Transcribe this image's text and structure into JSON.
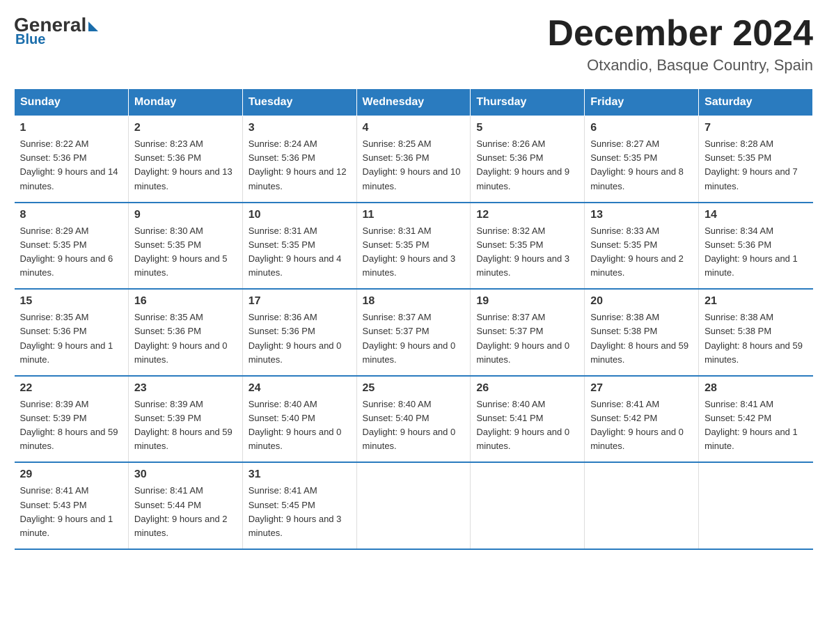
{
  "logo": {
    "general": "General",
    "blue": "Blue"
  },
  "header": {
    "month": "December 2024",
    "location": "Otxandio, Basque Country, Spain"
  },
  "weekdays": [
    "Sunday",
    "Monday",
    "Tuesday",
    "Wednesday",
    "Thursday",
    "Friday",
    "Saturday"
  ],
  "weeks": [
    [
      {
        "day": "1",
        "sunrise": "8:22 AM",
        "sunset": "5:36 PM",
        "daylight": "9 hours and 14 minutes."
      },
      {
        "day": "2",
        "sunrise": "8:23 AM",
        "sunset": "5:36 PM",
        "daylight": "9 hours and 13 minutes."
      },
      {
        "day": "3",
        "sunrise": "8:24 AM",
        "sunset": "5:36 PM",
        "daylight": "9 hours and 12 minutes."
      },
      {
        "day": "4",
        "sunrise": "8:25 AM",
        "sunset": "5:36 PM",
        "daylight": "9 hours and 10 minutes."
      },
      {
        "day": "5",
        "sunrise": "8:26 AM",
        "sunset": "5:36 PM",
        "daylight": "9 hours and 9 minutes."
      },
      {
        "day": "6",
        "sunrise": "8:27 AM",
        "sunset": "5:35 PM",
        "daylight": "9 hours and 8 minutes."
      },
      {
        "day": "7",
        "sunrise": "8:28 AM",
        "sunset": "5:35 PM",
        "daylight": "9 hours and 7 minutes."
      }
    ],
    [
      {
        "day": "8",
        "sunrise": "8:29 AM",
        "sunset": "5:35 PM",
        "daylight": "9 hours and 6 minutes."
      },
      {
        "day": "9",
        "sunrise": "8:30 AM",
        "sunset": "5:35 PM",
        "daylight": "9 hours and 5 minutes."
      },
      {
        "day": "10",
        "sunrise": "8:31 AM",
        "sunset": "5:35 PM",
        "daylight": "9 hours and 4 minutes."
      },
      {
        "day": "11",
        "sunrise": "8:31 AM",
        "sunset": "5:35 PM",
        "daylight": "9 hours and 3 minutes."
      },
      {
        "day": "12",
        "sunrise": "8:32 AM",
        "sunset": "5:35 PM",
        "daylight": "9 hours and 3 minutes."
      },
      {
        "day": "13",
        "sunrise": "8:33 AM",
        "sunset": "5:35 PM",
        "daylight": "9 hours and 2 minutes."
      },
      {
        "day": "14",
        "sunrise": "8:34 AM",
        "sunset": "5:36 PM",
        "daylight": "9 hours and 1 minute."
      }
    ],
    [
      {
        "day": "15",
        "sunrise": "8:35 AM",
        "sunset": "5:36 PM",
        "daylight": "9 hours and 1 minute."
      },
      {
        "day": "16",
        "sunrise": "8:35 AM",
        "sunset": "5:36 PM",
        "daylight": "9 hours and 0 minutes."
      },
      {
        "day": "17",
        "sunrise": "8:36 AM",
        "sunset": "5:36 PM",
        "daylight": "9 hours and 0 minutes."
      },
      {
        "day": "18",
        "sunrise": "8:37 AM",
        "sunset": "5:37 PM",
        "daylight": "9 hours and 0 minutes."
      },
      {
        "day": "19",
        "sunrise": "8:37 AM",
        "sunset": "5:37 PM",
        "daylight": "9 hours and 0 minutes."
      },
      {
        "day": "20",
        "sunrise": "8:38 AM",
        "sunset": "5:38 PM",
        "daylight": "8 hours and 59 minutes."
      },
      {
        "day": "21",
        "sunrise": "8:38 AM",
        "sunset": "5:38 PM",
        "daylight": "8 hours and 59 minutes."
      }
    ],
    [
      {
        "day": "22",
        "sunrise": "8:39 AM",
        "sunset": "5:39 PM",
        "daylight": "8 hours and 59 minutes."
      },
      {
        "day": "23",
        "sunrise": "8:39 AM",
        "sunset": "5:39 PM",
        "daylight": "8 hours and 59 minutes."
      },
      {
        "day": "24",
        "sunrise": "8:40 AM",
        "sunset": "5:40 PM",
        "daylight": "9 hours and 0 minutes."
      },
      {
        "day": "25",
        "sunrise": "8:40 AM",
        "sunset": "5:40 PM",
        "daylight": "9 hours and 0 minutes."
      },
      {
        "day": "26",
        "sunrise": "8:40 AM",
        "sunset": "5:41 PM",
        "daylight": "9 hours and 0 minutes."
      },
      {
        "day": "27",
        "sunrise": "8:41 AM",
        "sunset": "5:42 PM",
        "daylight": "9 hours and 0 minutes."
      },
      {
        "day": "28",
        "sunrise": "8:41 AM",
        "sunset": "5:42 PM",
        "daylight": "9 hours and 1 minute."
      }
    ],
    [
      {
        "day": "29",
        "sunrise": "8:41 AM",
        "sunset": "5:43 PM",
        "daylight": "9 hours and 1 minute."
      },
      {
        "day": "30",
        "sunrise": "8:41 AM",
        "sunset": "5:44 PM",
        "daylight": "9 hours and 2 minutes."
      },
      {
        "day": "31",
        "sunrise": "8:41 AM",
        "sunset": "5:45 PM",
        "daylight": "9 hours and 3 minutes."
      },
      null,
      null,
      null,
      null
    ]
  ],
  "labels": {
    "sunrise": "Sunrise:",
    "sunset": "Sunset:",
    "daylight": "Daylight:"
  }
}
